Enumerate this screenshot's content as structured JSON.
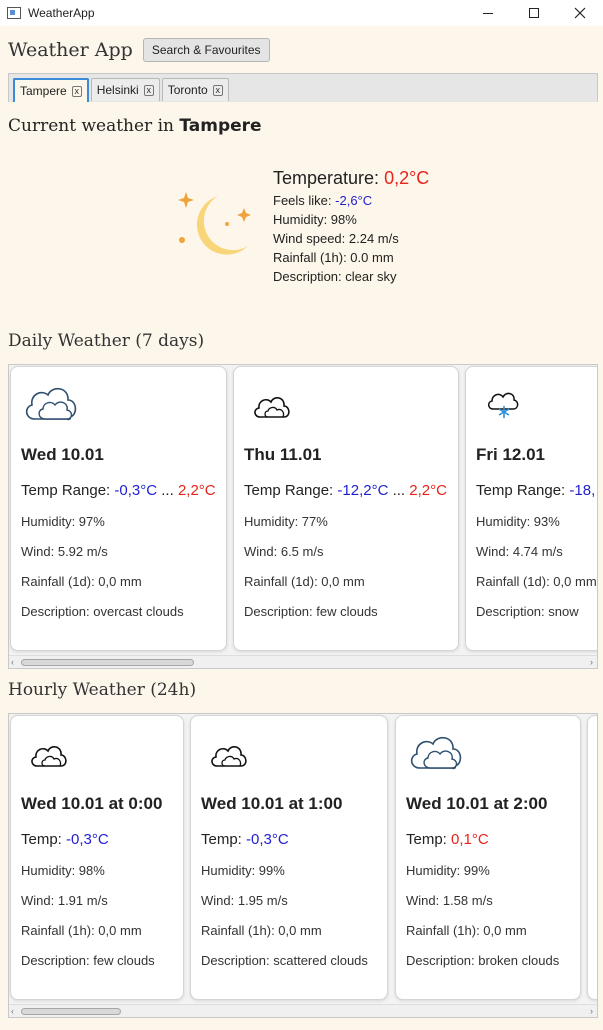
{
  "window": {
    "title": "WeatherApp"
  },
  "header": {
    "app_name": "Weather App",
    "search_button": "Search & Favourites"
  },
  "tabs": [
    {
      "label": "Tampere",
      "active": true
    },
    {
      "label": "Helsinki",
      "active": false
    },
    {
      "label": "Toronto",
      "active": false
    }
  ],
  "tab_close_glyph": "x",
  "current": {
    "heading_prefix": "Current weather in",
    "city": "Tampere",
    "icon": "crescent-moon-stars-icon",
    "temperature_label": "Temperature:",
    "temperature_value": "0,2°C",
    "feels_like_label": "Feels like:",
    "feels_like_value": "-2,6°C",
    "humidity": "Humidity: 98%",
    "wind": "Wind speed: 2.24 m/s",
    "rainfall": "Rainfall (1h): 0.0 mm",
    "description": "Description: clear sky"
  },
  "daily": {
    "title": "Daily Weather (7 days)",
    "cards": [
      {
        "icon": "overcast-clouds-icon",
        "day": "Wed 10.01",
        "range_label": "Temp Range:",
        "low": "-0,3°C",
        "sep": "...",
        "high": "2,2°C",
        "humidity": "Humidity: 97%",
        "wind": "Wind: 5.92 m/s",
        "rainfall": "Rainfall (1d): 0,0 mm",
        "description": "Description: overcast clouds"
      },
      {
        "icon": "few-clouds-icon",
        "day": "Thu 11.01",
        "range_label": "Temp Range:",
        "low": "-12,2°C",
        "sep": "...",
        "high": "2,2°C",
        "humidity": "Humidity: 77%",
        "wind": "Wind: 6.5 m/s",
        "rainfall": "Rainfall (1d): 0,0 mm",
        "description": "Description: few clouds"
      },
      {
        "icon": "snow-cloud-icon",
        "day": "Fri 12.01",
        "range_label": "Temp Range:",
        "low": "-18,",
        "sep": "",
        "high": "",
        "humidity": "Humidity: 93%",
        "wind": "Wind: 4.74 m/s",
        "rainfall": "Rainfall (1d): 0,0 mm",
        "description": "Description: snow"
      }
    ]
  },
  "hourly": {
    "title": "Hourly Weather (24h)",
    "cards": [
      {
        "icon": "few-clouds-icon",
        "time": "Wed 10.01 at 0:00",
        "temp_label": "Temp:",
        "temp": "-0,3°C",
        "temp_color": "#1f1fd0",
        "humidity": "Humidity: 98%",
        "wind": "Wind: 1.91 m/s",
        "rainfall": "Rainfall (1h): 0,0 mm",
        "description": "Description: few clouds"
      },
      {
        "icon": "scattered-clouds-icon",
        "time": "Wed 10.01 at 1:00",
        "temp_label": "Temp:",
        "temp": "-0,3°C",
        "temp_color": "#1f1fd0",
        "humidity": "Humidity: 99%",
        "wind": "Wind: 1.95 m/s",
        "rainfall": "Rainfall (1h): 0,0 mm",
        "description": "Description: scattered clouds"
      },
      {
        "icon": "broken-clouds-icon",
        "time": "Wed 10.01 at 2:00",
        "temp_label": "Temp:",
        "temp": "0,1°C",
        "temp_color": "#e8231c",
        "humidity": "Humidity: 99%",
        "wind": "Wind: 1.58 m/s",
        "rainfall": "Rainfall (1h): 0,0 mm",
        "description": "Description: broken clouds"
      }
    ]
  },
  "colors": {
    "cold": "#1f1fd0",
    "warm": "#e8231c",
    "background": "#fdf6ea",
    "tab_focus": "#3c8bd6"
  }
}
